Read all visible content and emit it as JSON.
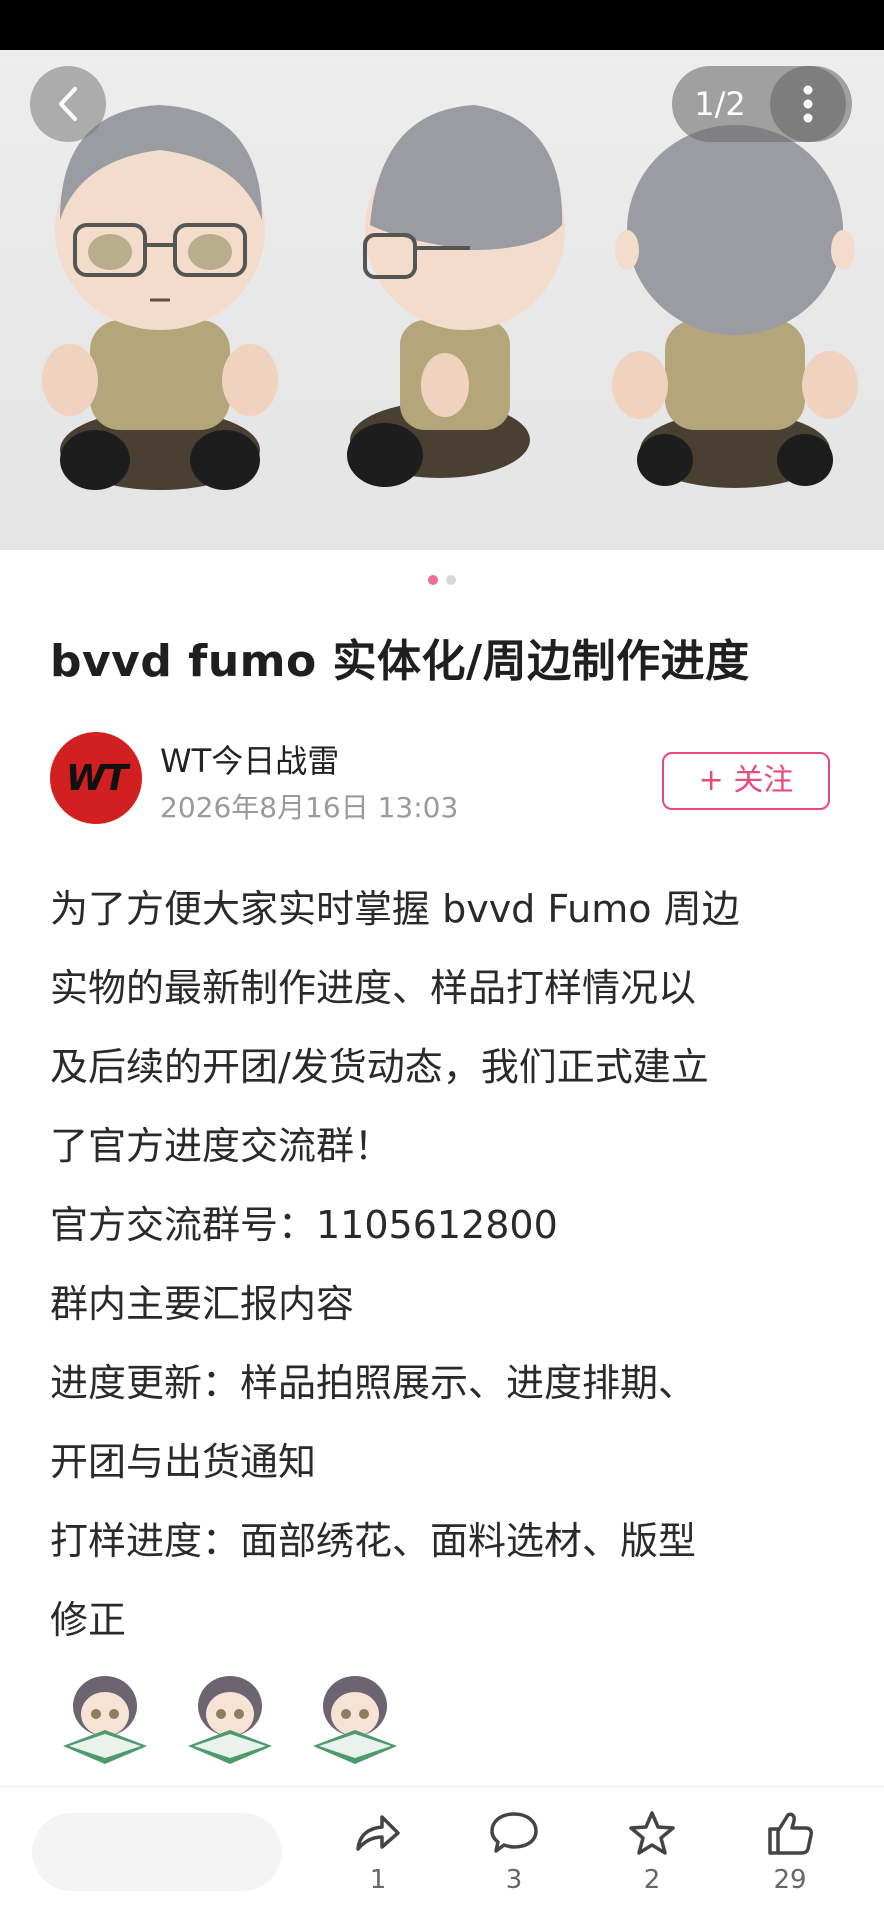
{
  "gallery": {
    "counter": "1/2",
    "total_pages": 2,
    "current_page": 1
  },
  "post": {
    "title": "bvvd fumo 实体化/周边制作进度",
    "author": {
      "avatar_text": "WT",
      "name": "WT今日战雷",
      "date": "2026年8月16日 13:03"
    },
    "follow_label": "+ 关注",
    "body_lines": [
      "为了方便大家实时掌握 bvvd Fumo 周边",
      "实物的最新制作进度、样品打样情况以",
      "及后续的开团/发货动态，我们正式建立",
      "了官方进度交流群！",
      "官方交流群号：1105612800",
      "群内主要汇报内容",
      "进度更新：样品拍照展示、进度排期、",
      "开团与出货通知",
      "打样进度：面部绣花、面料选材、版型",
      "修正"
    ]
  },
  "bottom_bar": {
    "share_count": "1",
    "comment_count": "3",
    "favorite_count": "2",
    "like_count": "29"
  },
  "colors": {
    "accent": "#e84a7a",
    "dot_active": "#f26d8f",
    "avatar_bg": "#d21f1f"
  }
}
